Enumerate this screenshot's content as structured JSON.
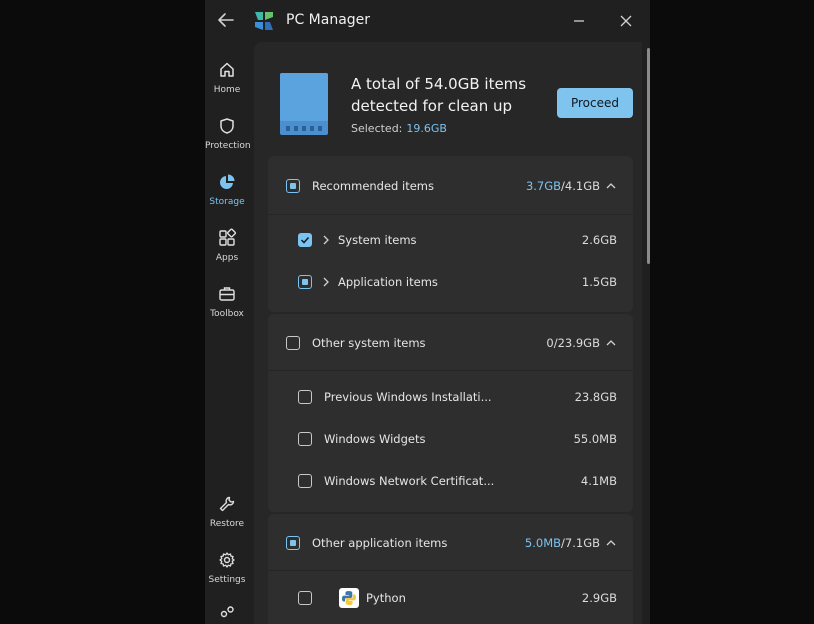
{
  "window": {
    "title": "PC Manager",
    "icons": {
      "back": "back-arrow-icon",
      "logo": "pc-manager-logo-icon",
      "minimize": "minimize-icon",
      "close": "close-icon"
    }
  },
  "nav": {
    "items": [
      {
        "label": "Home",
        "icon": "home-icon"
      },
      {
        "label": "Protection",
        "icon": "shield-icon"
      },
      {
        "label": "Storage",
        "icon": "pie-chart-icon",
        "active": true
      },
      {
        "label": "Apps",
        "icon": "apps-grid-icon"
      },
      {
        "label": "Toolbox",
        "icon": "toolbox-icon"
      },
      {
        "label": "Restore",
        "icon": "wrench-icon"
      },
      {
        "label": "Settings",
        "icon": "gear-icon"
      }
    ]
  },
  "summary": {
    "title": "A total of 54.0GB items detected for clean up",
    "selected_label": "Selected:",
    "selected_value": "19.6GB",
    "proceed_label": "Proceed"
  },
  "groups": {
    "recommended": {
      "label": "Recommended items",
      "size_selected": "3.7GB",
      "size_total": "/4.1GB",
      "items": [
        {
          "label": "System items",
          "size": "2.6GB",
          "state": "checked"
        },
        {
          "label": "Application items",
          "size": "1.5GB",
          "state": "partial"
        }
      ]
    },
    "other_system": {
      "label": "Other system items",
      "size": "0/23.9GB",
      "items": [
        {
          "label": "Previous Windows Installati...",
          "size": "23.8GB"
        },
        {
          "label": "Windows Widgets",
          "size": "55.0MB"
        },
        {
          "label": "Windows Network Certificat...",
          "size": "4.1MB"
        }
      ]
    },
    "other_application": {
      "label": "Other application items",
      "size_selected": "5.0MB",
      "size_total": "/7.1GB",
      "items": [
        {
          "label": "Python",
          "size": "2.9GB",
          "icon": "python-icon"
        }
      ]
    }
  },
  "colors": {
    "accent": "#7cc3ef",
    "background": "#202020",
    "card": "#2e2e2e"
  }
}
